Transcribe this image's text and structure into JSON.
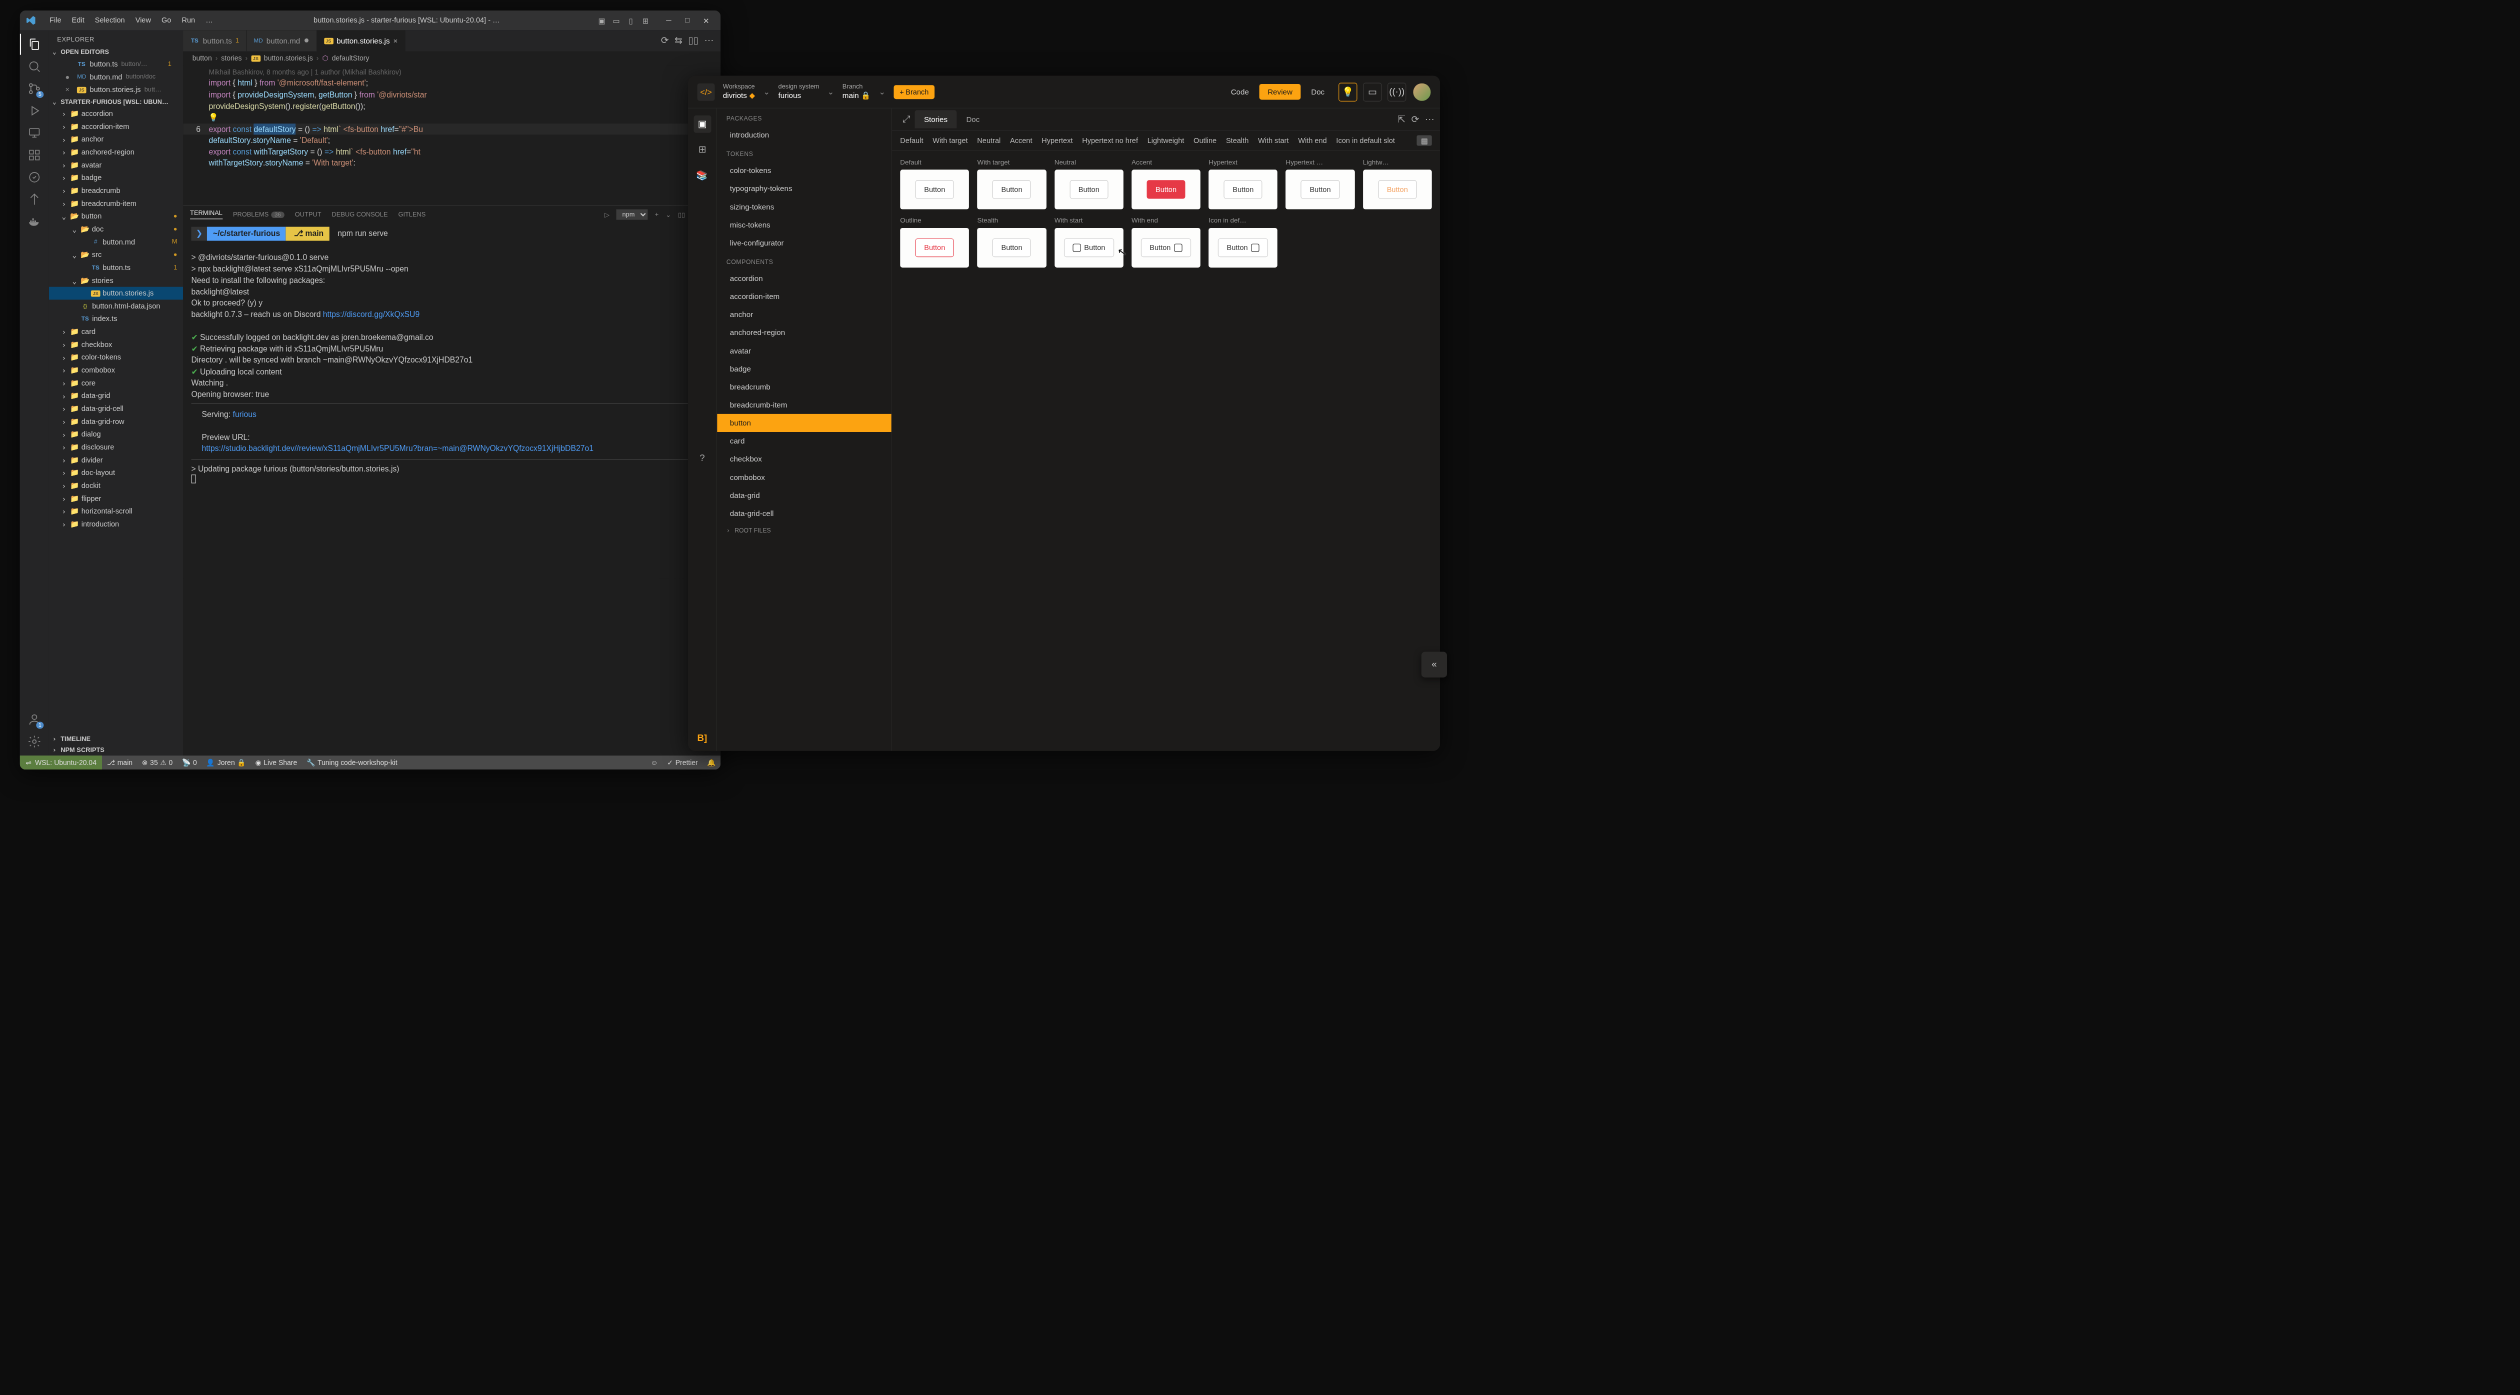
{
  "vscode": {
    "menus": [
      "File",
      "Edit",
      "Selection",
      "View",
      "Go",
      "Run",
      "…"
    ],
    "title": "button.stories.js - starter-furious [WSL: Ubuntu-20.04] - …",
    "explorer_title": "EXPLORER",
    "open_editors_hdr": "OPEN EDITORS",
    "open_editors": [
      {
        "icon": "TS",
        "name": "button.ts",
        "path": "button/…",
        "decoration": "1"
      },
      {
        "icon": "MD",
        "name": "button.md",
        "path": "button/doc",
        "modified": true
      },
      {
        "icon": "JS",
        "name": "button.stories.js",
        "path": "butt…",
        "close": true
      }
    ],
    "workspace_hdr": "STARTER-FURIOUS [WSL: UBUN…",
    "tree": [
      {
        "d": 1,
        "t": "folder",
        "n": "accordion"
      },
      {
        "d": 1,
        "t": "folder",
        "n": "accordion-item"
      },
      {
        "d": 1,
        "t": "folder",
        "n": "anchor"
      },
      {
        "d": 1,
        "t": "folder",
        "n": "anchored-region"
      },
      {
        "d": 1,
        "t": "folder",
        "n": "avatar"
      },
      {
        "d": 1,
        "t": "folder",
        "n": "badge"
      },
      {
        "d": 1,
        "t": "folder",
        "n": "breadcrumb"
      },
      {
        "d": 1,
        "t": "folder",
        "n": "breadcrumb-item"
      },
      {
        "d": 1,
        "t": "folder-open",
        "n": "button",
        "dec": "●"
      },
      {
        "d": 2,
        "t": "folder-open",
        "n": "doc",
        "dec": "●"
      },
      {
        "d": 3,
        "t": "md",
        "n": "button.md",
        "dec": "M"
      },
      {
        "d": 2,
        "t": "folder-open",
        "n": "src",
        "dec": "●"
      },
      {
        "d": 3,
        "t": "ts",
        "n": "button.ts",
        "dec": "1"
      },
      {
        "d": 2,
        "t": "folder-open",
        "n": "stories"
      },
      {
        "d": 3,
        "t": "js",
        "n": "button.stories.js",
        "sel": true
      },
      {
        "d": 2,
        "t": "json",
        "n": "button.html-data.json"
      },
      {
        "d": 2,
        "t": "ts",
        "n": "index.ts"
      },
      {
        "d": 1,
        "t": "folder",
        "n": "card"
      },
      {
        "d": 1,
        "t": "folder",
        "n": "checkbox"
      },
      {
        "d": 1,
        "t": "folder",
        "n": "color-tokens"
      },
      {
        "d": 1,
        "t": "folder",
        "n": "combobox"
      },
      {
        "d": 1,
        "t": "folder",
        "n": "core"
      },
      {
        "d": 1,
        "t": "folder",
        "n": "data-grid"
      },
      {
        "d": 1,
        "t": "folder",
        "n": "data-grid-cell"
      },
      {
        "d": 1,
        "t": "folder",
        "n": "data-grid-row"
      },
      {
        "d": 1,
        "t": "folder",
        "n": "dialog"
      },
      {
        "d": 1,
        "t": "folder",
        "n": "disclosure"
      },
      {
        "d": 1,
        "t": "folder",
        "n": "divider"
      },
      {
        "d": 1,
        "t": "folder",
        "n": "doc-layout"
      },
      {
        "d": 1,
        "t": "folder",
        "n": "dockit"
      },
      {
        "d": 1,
        "t": "folder",
        "n": "flipper"
      },
      {
        "d": 1,
        "t": "folder",
        "n": "horizontal-scroll"
      },
      {
        "d": 1,
        "t": "folder",
        "n": "introduction"
      }
    ],
    "bottom_sections": [
      "TIMELINE",
      "NPM SCRIPTS"
    ],
    "tabs": [
      {
        "icon": "TS",
        "name": "button.ts",
        "decoration": "1"
      },
      {
        "icon": "MD",
        "name": "button.md",
        "modified": true
      },
      {
        "icon": "JS",
        "name": "button.stories.js",
        "active": true,
        "close": true
      }
    ],
    "breadcrumb": [
      "button",
      "stories",
      "button.stories.js",
      "defaultStory"
    ],
    "blame": "Mikhail Bashkirov, 8 months ago | 1 author (Mikhail Bashkirov)",
    "panel_tabs": [
      "TERMINAL",
      "PROBLEMS",
      "OUTPUT",
      "DEBUG CONSOLE",
      "GITLENS"
    ],
    "problems_count": "36",
    "panel_task": "npm",
    "prompt_path": "~/c/starter-furious",
    "prompt_branch": "main",
    "prompt_cmd": "npm run serve",
    "term_lines": [
      "> @divriots/starter-furious@0.1.0 serve",
      "> npx backlight@latest serve xS11aQmjMLIvr5PU5Mru --open",
      "",
      "Need to install the following packages:",
      "  backlight@latest",
      "Ok to proceed? (y) y"
    ],
    "term_reach": "backlight 0.7.3 – reach us on Discord ",
    "term_discord": "https://discord.gg/XkQxSU9",
    "term_success": [
      "Successfully logged on backlight.dev as joren.broekema@gmail.co",
      "Retrieving package with id xS11aQmjMLIvr5PU5Mru"
    ],
    "term_dir": "Directory . will be synced with branch ~main@RWNyOkzvYQfzocx91XjHDB27o1",
    "term_upload": "Uploading local content",
    "term_watch": "Watching .",
    "term_open": "Opening browser: true",
    "term_serving_label": "Serving:",
    "term_serving_val": "furious",
    "term_preview_label": "Preview URL:",
    "term_preview_url": "https://studio.backlight.dev//review/xS11aQmjMLIvr5PU5Mru?bran=~main@RWNyOkzvYQfzocx91XjHjbDB27o1",
    "term_updating": "> Updating package furious (button/stories/button.stories.js)",
    "status": {
      "remote": "WSL: Ubuntu-20.04",
      "branch": "main",
      "errors": "35",
      "warnings": "0",
      "port": "0",
      "user": "Joren",
      "liveshare": "Live Share",
      "tuning": "Tuning code-workshop-kit",
      "prettier": "Prettier"
    }
  },
  "backlight": {
    "workspace_label": "Workspace",
    "workspace_name": "divriots",
    "ds_label": "design system",
    "ds_name": "furious",
    "branch_label": "Branch",
    "branch_name": "main",
    "branch_btn": "Branch",
    "nav": [
      "Code",
      "Review",
      "Doc"
    ],
    "nav_active": "Review",
    "packages_hdr": "PACKAGES",
    "intro": "introduction",
    "tokens_hdr": "TOKENS",
    "tokens": [
      "color-tokens",
      "typography-tokens",
      "sizing-tokens",
      "misc-tokens",
      "live-configurator"
    ],
    "components_hdr": "COMPONENTS",
    "components": [
      "accordion",
      "accordion-item",
      "anchor",
      "anchored-region",
      "avatar",
      "badge",
      "breadcrumb",
      "breadcrumb-item",
      "button",
      "card",
      "checkbox",
      "combobox",
      "data-grid",
      "data-grid-cell"
    ],
    "components_active": "button",
    "root_files": "ROOT FILES",
    "main_tabs": [
      "Stories",
      "Doc"
    ],
    "main_active": "Stories",
    "filters": [
      "Default",
      "With target",
      "Neutral",
      "Accent",
      "Hypertext",
      "Hypertext no href",
      "Lightweight",
      "Outline",
      "Stealth",
      "With start",
      "With end",
      "Icon in default slot"
    ],
    "cards": [
      {
        "label": "Default",
        "variant": ""
      },
      {
        "label": "With target",
        "variant": ""
      },
      {
        "label": "Neutral",
        "variant": ""
      },
      {
        "label": "Accent",
        "variant": "accent"
      },
      {
        "label": "Hypertext",
        "variant": ""
      },
      {
        "label": "Hypertext …",
        "variant": ""
      },
      {
        "label": "Lightw…",
        "variant": "light"
      },
      {
        "label": "Outline",
        "variant": "outline"
      },
      {
        "label": "Stealth",
        "variant": ""
      },
      {
        "label": "With start",
        "variant": "",
        "iconStart": true
      },
      {
        "label": "With end",
        "variant": "",
        "iconEnd": true
      },
      {
        "label": "Icon in def…",
        "variant": "",
        "iconEnd": true
      }
    ],
    "button_text": "Button"
  }
}
